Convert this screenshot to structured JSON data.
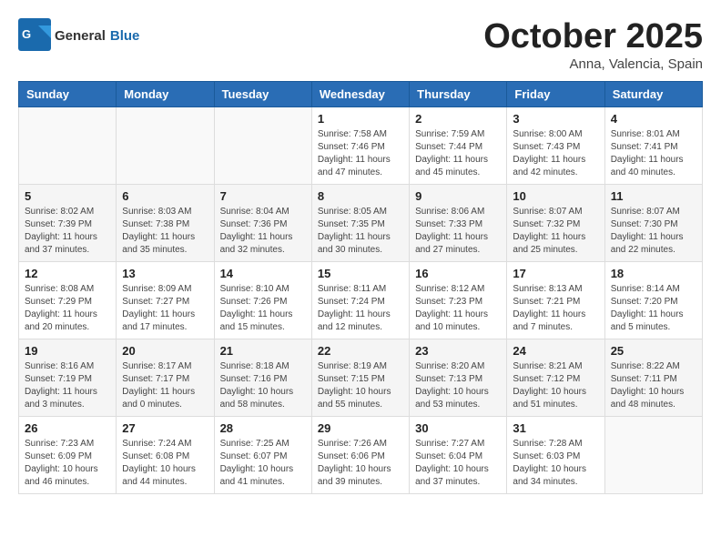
{
  "header": {
    "logo_general": "General",
    "logo_blue": "Blue",
    "month": "October 2025",
    "location": "Anna, Valencia, Spain"
  },
  "days_of_week": [
    "Sunday",
    "Monday",
    "Tuesday",
    "Wednesday",
    "Thursday",
    "Friday",
    "Saturday"
  ],
  "weeks": [
    [
      {
        "day": "",
        "info": ""
      },
      {
        "day": "",
        "info": ""
      },
      {
        "day": "",
        "info": ""
      },
      {
        "day": "1",
        "info": "Sunrise: 7:58 AM\nSunset: 7:46 PM\nDaylight: 11 hours\nand 47 minutes."
      },
      {
        "day": "2",
        "info": "Sunrise: 7:59 AM\nSunset: 7:44 PM\nDaylight: 11 hours\nand 45 minutes."
      },
      {
        "day": "3",
        "info": "Sunrise: 8:00 AM\nSunset: 7:43 PM\nDaylight: 11 hours\nand 42 minutes."
      },
      {
        "day": "4",
        "info": "Sunrise: 8:01 AM\nSunset: 7:41 PM\nDaylight: 11 hours\nand 40 minutes."
      }
    ],
    [
      {
        "day": "5",
        "info": "Sunrise: 8:02 AM\nSunset: 7:39 PM\nDaylight: 11 hours\nand 37 minutes."
      },
      {
        "day": "6",
        "info": "Sunrise: 8:03 AM\nSunset: 7:38 PM\nDaylight: 11 hours\nand 35 minutes."
      },
      {
        "day": "7",
        "info": "Sunrise: 8:04 AM\nSunset: 7:36 PM\nDaylight: 11 hours\nand 32 minutes."
      },
      {
        "day": "8",
        "info": "Sunrise: 8:05 AM\nSunset: 7:35 PM\nDaylight: 11 hours\nand 30 minutes."
      },
      {
        "day": "9",
        "info": "Sunrise: 8:06 AM\nSunset: 7:33 PM\nDaylight: 11 hours\nand 27 minutes."
      },
      {
        "day": "10",
        "info": "Sunrise: 8:07 AM\nSunset: 7:32 PM\nDaylight: 11 hours\nand 25 minutes."
      },
      {
        "day": "11",
        "info": "Sunrise: 8:07 AM\nSunset: 7:30 PM\nDaylight: 11 hours\nand 22 minutes."
      }
    ],
    [
      {
        "day": "12",
        "info": "Sunrise: 8:08 AM\nSunset: 7:29 PM\nDaylight: 11 hours\nand 20 minutes."
      },
      {
        "day": "13",
        "info": "Sunrise: 8:09 AM\nSunset: 7:27 PM\nDaylight: 11 hours\nand 17 minutes."
      },
      {
        "day": "14",
        "info": "Sunrise: 8:10 AM\nSunset: 7:26 PM\nDaylight: 11 hours\nand 15 minutes."
      },
      {
        "day": "15",
        "info": "Sunrise: 8:11 AM\nSunset: 7:24 PM\nDaylight: 11 hours\nand 12 minutes."
      },
      {
        "day": "16",
        "info": "Sunrise: 8:12 AM\nSunset: 7:23 PM\nDaylight: 11 hours\nand 10 minutes."
      },
      {
        "day": "17",
        "info": "Sunrise: 8:13 AM\nSunset: 7:21 PM\nDaylight: 11 hours\nand 7 minutes."
      },
      {
        "day": "18",
        "info": "Sunrise: 8:14 AM\nSunset: 7:20 PM\nDaylight: 11 hours\nand 5 minutes."
      }
    ],
    [
      {
        "day": "19",
        "info": "Sunrise: 8:16 AM\nSunset: 7:19 PM\nDaylight: 11 hours\nand 3 minutes."
      },
      {
        "day": "20",
        "info": "Sunrise: 8:17 AM\nSunset: 7:17 PM\nDaylight: 11 hours\nand 0 minutes."
      },
      {
        "day": "21",
        "info": "Sunrise: 8:18 AM\nSunset: 7:16 PM\nDaylight: 10 hours\nand 58 minutes."
      },
      {
        "day": "22",
        "info": "Sunrise: 8:19 AM\nSunset: 7:15 PM\nDaylight: 10 hours\nand 55 minutes."
      },
      {
        "day": "23",
        "info": "Sunrise: 8:20 AM\nSunset: 7:13 PM\nDaylight: 10 hours\nand 53 minutes."
      },
      {
        "day": "24",
        "info": "Sunrise: 8:21 AM\nSunset: 7:12 PM\nDaylight: 10 hours\nand 51 minutes."
      },
      {
        "day": "25",
        "info": "Sunrise: 8:22 AM\nSunset: 7:11 PM\nDaylight: 10 hours\nand 48 minutes."
      }
    ],
    [
      {
        "day": "26",
        "info": "Sunrise: 7:23 AM\nSunset: 6:09 PM\nDaylight: 10 hours\nand 46 minutes."
      },
      {
        "day": "27",
        "info": "Sunrise: 7:24 AM\nSunset: 6:08 PM\nDaylight: 10 hours\nand 44 minutes."
      },
      {
        "day": "28",
        "info": "Sunrise: 7:25 AM\nSunset: 6:07 PM\nDaylight: 10 hours\nand 41 minutes."
      },
      {
        "day": "29",
        "info": "Sunrise: 7:26 AM\nSunset: 6:06 PM\nDaylight: 10 hours\nand 39 minutes."
      },
      {
        "day": "30",
        "info": "Sunrise: 7:27 AM\nSunset: 6:04 PM\nDaylight: 10 hours\nand 37 minutes."
      },
      {
        "day": "31",
        "info": "Sunrise: 7:28 AM\nSunset: 6:03 PM\nDaylight: 10 hours\nand 34 minutes."
      },
      {
        "day": "",
        "info": ""
      }
    ]
  ]
}
